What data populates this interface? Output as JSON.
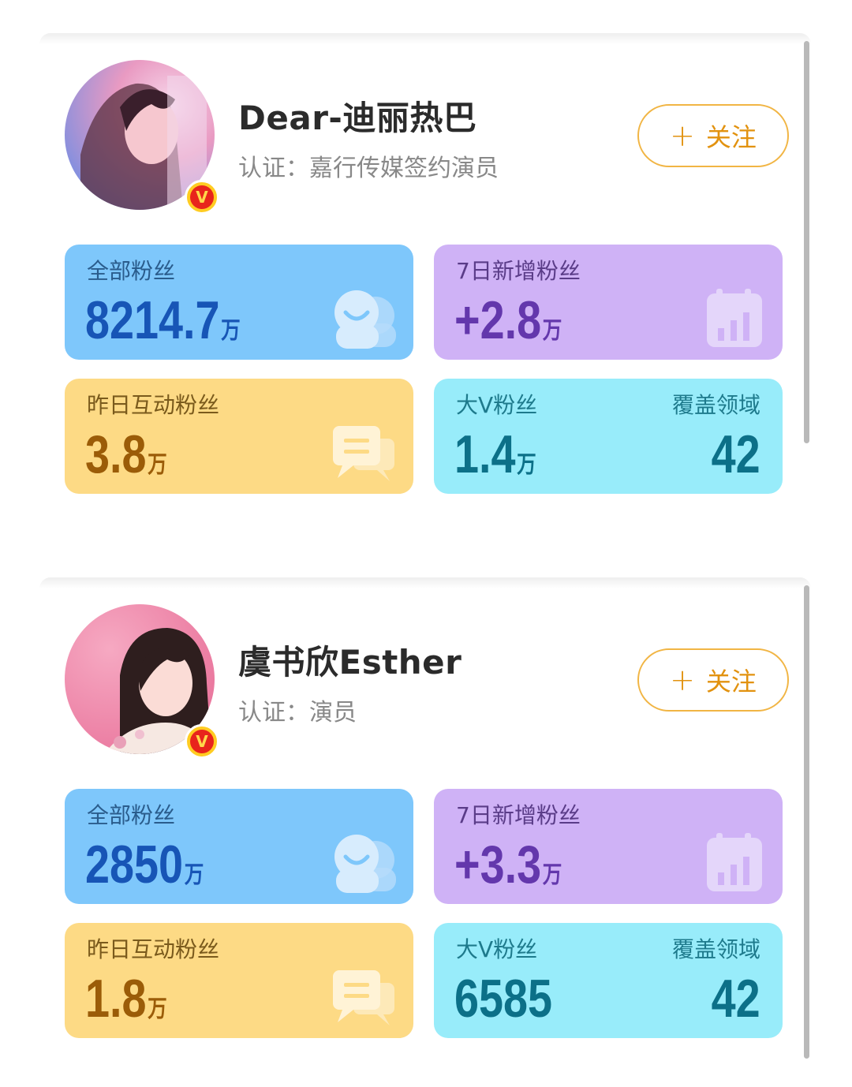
{
  "profiles": [
    {
      "name": "Dear-迪丽热巴",
      "certification": "认证：嘉行传媒签约演员",
      "follow_label": "关注",
      "follow_plus": "+",
      "badge": "V",
      "avatar_colors": [
        "#f3a6c6",
        "#8fa6e8",
        "#f6d2e2"
      ],
      "stats": {
        "total_fans": {
          "label": "全部粉丝",
          "value": "8214.7",
          "unit": "万",
          "icon": "users-icon"
        },
        "new_fans_7d": {
          "label": "7日新增粉丝",
          "value": "+2.8",
          "unit": "万",
          "icon": "bar-chart-icon"
        },
        "active_fans_yesterday": {
          "label": "昨日互动粉丝",
          "value": "3.8",
          "unit": "万",
          "icon": "chat-bubbles-icon"
        },
        "big_v_fans": {
          "label": "大V粉丝",
          "value": "1.4",
          "unit": "万",
          "coverage_label": "覆盖领域",
          "coverage_value": "42"
        }
      }
    },
    {
      "name": "虞书欣Esther",
      "certification": "认证：演员",
      "follow_label": "关注",
      "follow_plus": "+",
      "badge": "V",
      "avatar_colors": [
        "#f08fb0",
        "#f6c2d4",
        "#3a2a2a"
      ],
      "stats": {
        "total_fans": {
          "label": "全部粉丝",
          "value": "2850",
          "unit": "万",
          "icon": "users-icon"
        },
        "new_fans_7d": {
          "label": "7日新增粉丝",
          "value": "+3.3",
          "unit": "万",
          "icon": "bar-chart-icon"
        },
        "active_fans_yesterday": {
          "label": "昨日互动粉丝",
          "value": "1.8",
          "unit": "万",
          "icon": "chat-bubbles-icon"
        },
        "big_v_fans": {
          "label": "大V粉丝",
          "value": "6585",
          "unit": "",
          "coverage_label": "覆盖领域",
          "coverage_value": "42"
        }
      }
    }
  ]
}
